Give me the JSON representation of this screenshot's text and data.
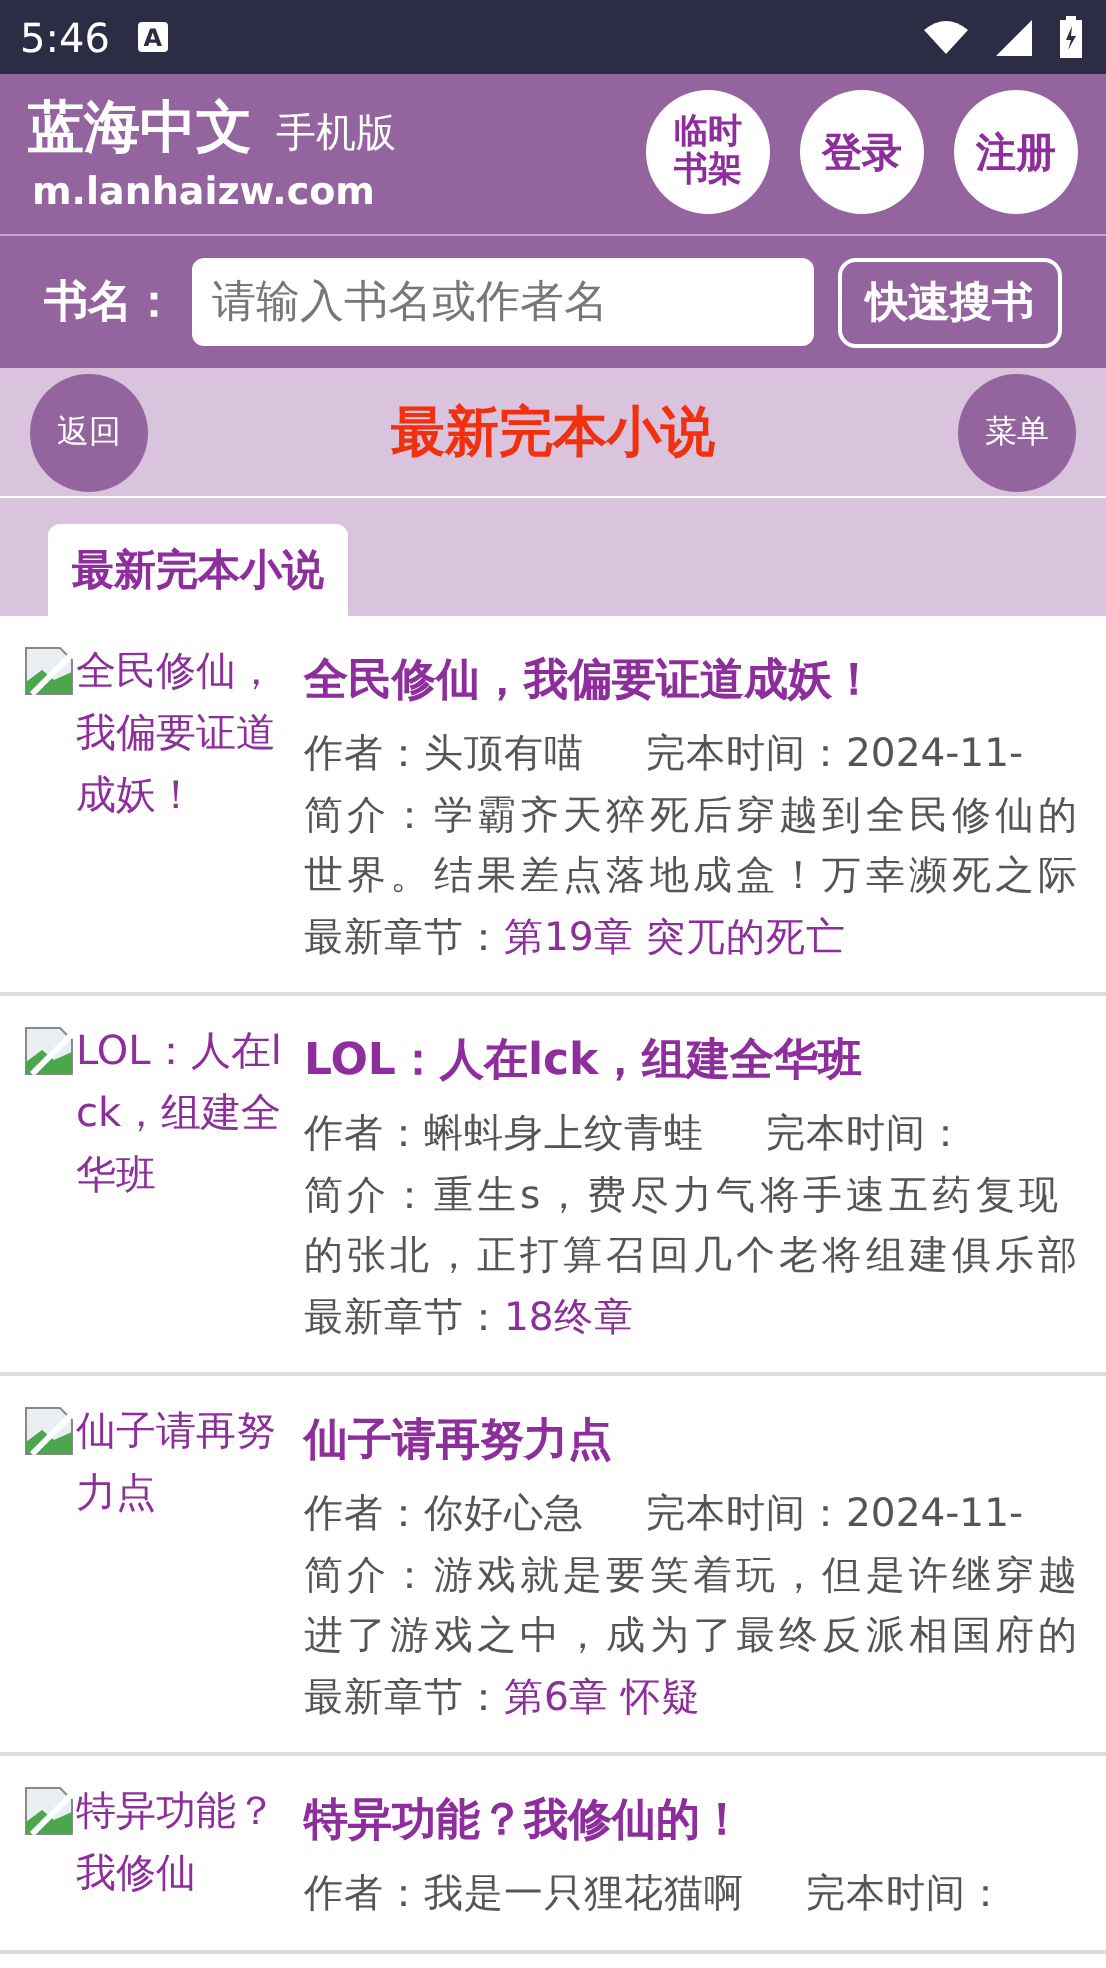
{
  "status_bar": {
    "time": "5:46",
    "notification_glyph": "A"
  },
  "header": {
    "site_name": "蓝海中文",
    "edition": "手机版",
    "domain": "m.lanhaizw.com",
    "buttons": [
      "临时书架",
      "登录",
      "注册"
    ]
  },
  "search": {
    "label": "书名：",
    "placeholder": "请输入书名或作者名",
    "button": "快速搜书"
  },
  "nav": {
    "back": "返回",
    "title": "最新完本小说",
    "menu": "菜单"
  },
  "tabs": [
    {
      "label": "最新完本小说",
      "selected": true
    }
  ],
  "books": [
    {
      "cover_alt": "全民修仙，我偏要证道成妖！",
      "title": "全民修仙，我偏要证道成妖！",
      "author_label": "作者：",
      "author": "头顶有喵",
      "time_label": "完本时间：",
      "time": "2024-11-",
      "intro_label": "简介：",
      "intro": "学霸齐天猝死后穿越到全民修仙的世界。结果差点落地成盒！万幸濒死之际",
      "chapter_label": "最新章节：",
      "chapter": "第19章 突兀的死亡"
    },
    {
      "cover_alt": "LOL：人在lck，组建全华班",
      "title": "LOL：人在lck，组建全华班",
      "author_label": "作者：",
      "author": "蝌蚪身上纹青蛙",
      "time_label": "完本时间：",
      "intro_label": "简介：",
      "intro": "重生s，费尽力气将手速五药复现的张北，正打算召回几个老将组建俱乐部",
      "chapter_label": "最新章节：",
      "chapter": "18终章"
    },
    {
      "cover_alt": "仙子请再努力点",
      "title": "仙子请再努力点",
      "author_label": "作者：",
      "author": "你好心急",
      "time_label": "完本时间：",
      "time": "2024-11-",
      "intro_label": "简介：",
      "intro": "游戏就是要笑着玩，但是许继穿越进了游戏之中，成为了最终反派相国府的",
      "chapter_label": "最新章节：",
      "chapter": "第6章 怀疑"
    },
    {
      "cover_alt": "特异功能？我修仙",
      "title": "特异功能？我修仙的！",
      "author_label": "作者：",
      "author": "我是一只狸花猫啊",
      "time_label": "完本时间："
    }
  ]
}
